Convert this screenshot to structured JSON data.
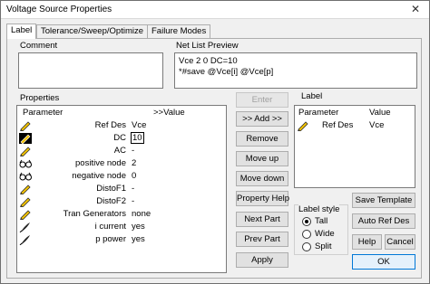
{
  "window": {
    "title": "Voltage Source Properties",
    "close_glyph": "✕"
  },
  "tabs": [
    {
      "label": "Label",
      "active": true
    },
    {
      "label": "Tolerance/Sweep/Optimize",
      "active": false
    },
    {
      "label": "Failure Modes",
      "active": false
    }
  ],
  "comment": {
    "label": "Comment",
    "value": ""
  },
  "netlist": {
    "label": "Net List Preview",
    "lines": [
      "Vce 2 0 DC=10",
      "*#save  @Vce[i] @Vce[p]"
    ]
  },
  "properties": {
    "label": "Properties",
    "header_param": "Parameter",
    "header_value": ">>Value",
    "rows": [
      {
        "icon": "pencil-icon",
        "name": "Ref Des",
        "value": "Vce"
      },
      {
        "icon": "pencil-selected-icon",
        "name": "DC",
        "value": "10",
        "editing": true
      },
      {
        "icon": "pencil-icon",
        "name": "AC",
        "value": "-"
      },
      {
        "icon": "glasses-icon",
        "name": "positive node",
        "value": "2"
      },
      {
        "icon": "glasses-icon",
        "name": "negative node",
        "value": "0"
      },
      {
        "icon": "pencil-icon",
        "name": "DistoF1",
        "value": "-"
      },
      {
        "icon": "pencil-icon",
        "name": "DistoF2",
        "value": "-"
      },
      {
        "icon": "pencil-icon",
        "name": "Tran Generators",
        "value": "none"
      },
      {
        "icon": "quill-icon",
        "name": "i current",
        "value": "yes"
      },
      {
        "icon": "quill-icon",
        "name": "p power",
        "value": "yes"
      }
    ]
  },
  "middle_buttons": {
    "enter": "Enter",
    "add": ">> Add >>",
    "remove": "Remove",
    "move_up": "Move up",
    "move_down": "Move down",
    "property_help": "Property Help",
    "next_part": "Next Part",
    "prev_part": "Prev Part",
    "apply": "Apply"
  },
  "label_panel": {
    "label": "Label",
    "header_param": "Parameter",
    "header_value": "Value",
    "rows": [
      {
        "icon": "pencil-icon",
        "name": "Ref Des",
        "value": "Vce"
      }
    ]
  },
  "label_style": {
    "label": "Label style",
    "options": [
      {
        "label": "Tall",
        "checked": true
      },
      {
        "label": "Wide",
        "checked": false
      },
      {
        "label": "Split",
        "checked": false
      }
    ]
  },
  "right_buttons": {
    "save_template": "Save Template",
    "auto_ref_des": "Auto Ref Des",
    "help": "Help",
    "cancel": "Cancel",
    "ok": "OK"
  },
  "colors": {
    "selection": "#000000",
    "ok_border": "#0078d7"
  }
}
